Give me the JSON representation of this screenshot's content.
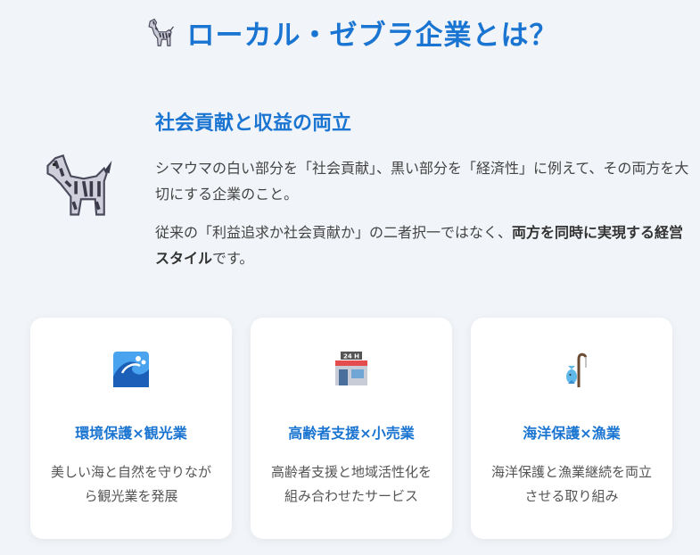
{
  "page": {
    "title": "ローカル・ゼブラ企業とは？"
  },
  "hero": {
    "subtitle": "社会貢献と収益の両立",
    "para1": "シマウマの白い部分を「社会貢献」、黒い部分を「経済性」に例えて、その両方を大切にする企業のこと。",
    "para2_prefix": "従来の「利益追求か社会貢献か」の二者択一ではなく、",
    "para2_bold": "両方を同時に実現する経営スタイル",
    "para2_suffix": "です。"
  },
  "cards": [
    {
      "icon": "wave-icon",
      "title": "環境保護×観光業",
      "desc": "美しい海と自然を守りながら観光業を発展"
    },
    {
      "icon": "convenience-store-icon",
      "title": "高齢者支援×小売業",
      "desc": "高齢者支援と地域活性化を組み合わせたサービス"
    },
    {
      "icon": "fishing-pole-icon",
      "title": "海洋保護×漁業",
      "desc": "海洋保護と漁業継続を両立させる取り組み"
    }
  ],
  "icons": {
    "title": "zebra-icon",
    "hero": "zebra-icon",
    "store_sign": "24 H"
  }
}
